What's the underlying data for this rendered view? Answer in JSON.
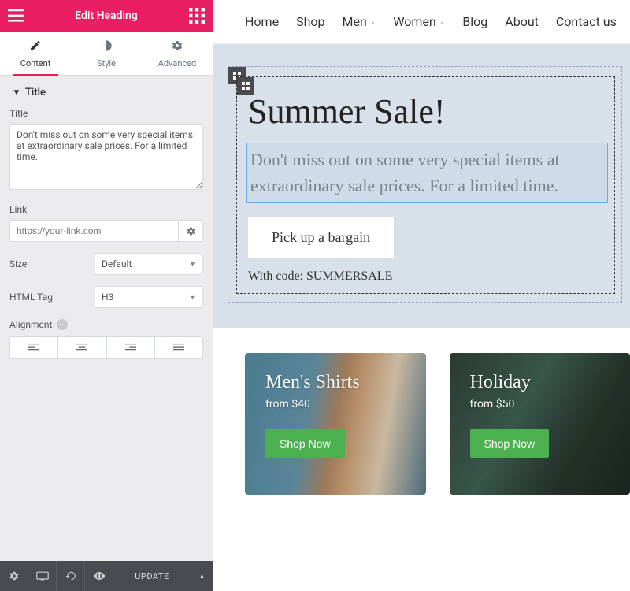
{
  "colors": {
    "accent_pink": "#e91e63",
    "success_green": "#4caf50",
    "bottombar": "#4a4b50"
  },
  "header": {
    "title": "Edit Heading"
  },
  "tabs": [
    {
      "label": "Content",
      "active": true
    },
    {
      "label": "Style",
      "active": false
    },
    {
      "label": "Advanced",
      "active": false
    }
  ],
  "section": {
    "title": "Title"
  },
  "fields": {
    "title_label": "Title",
    "title_value": "Don't miss out on some very special items at extraordinary sale prices. For a limited time.",
    "link_label": "Link",
    "link_placeholder": "https://your-link.com",
    "size_label": "Size",
    "size_value": "Default",
    "tag_label": "HTML Tag",
    "tag_value": "H3",
    "align_label": "Alignment"
  },
  "bottom": {
    "update": "UPDATE"
  },
  "nav": [
    {
      "label": "Home",
      "caret": false
    },
    {
      "label": "Shop",
      "caret": false
    },
    {
      "label": "Men",
      "caret": true
    },
    {
      "label": "Women",
      "caret": true
    },
    {
      "label": "Blog",
      "caret": false
    },
    {
      "label": "About",
      "caret": false
    },
    {
      "label": "Contact us",
      "caret": false
    }
  ],
  "hero": {
    "title": "Summer Sale!",
    "subtitle": "Don't miss out on some very special items at extraordinary sale prices. For a limited time.",
    "cta": "Pick up a bargain",
    "code_line": "With code: SUMMERSALE"
  },
  "products": [
    {
      "title": "Men's Shirts",
      "sub": "from $40",
      "btn": "Shop Now"
    },
    {
      "title": "Holiday",
      "sub": "from $50",
      "btn": "Shop Now"
    }
  ]
}
